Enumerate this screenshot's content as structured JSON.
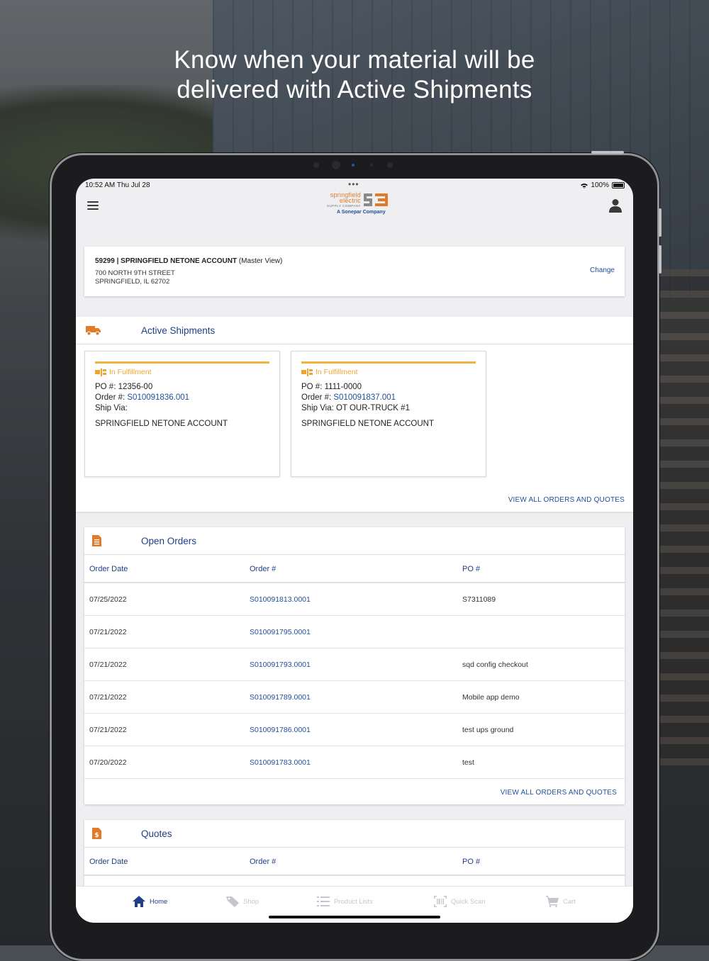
{
  "headline": {
    "line1": "Know when your material will be",
    "line2": "delivered with Active Shipments"
  },
  "status_bar": {
    "time": "10:52 AM   Thu Jul 28",
    "dots": "•••",
    "battery": "100%"
  },
  "logo": {
    "line1": "springfield",
    "line2": "electric",
    "supply": "SUPPLY COMPANY",
    "tagline": "A Sonepar Company"
  },
  "account": {
    "name": "59299 | SPRINGFIELD NETONE ACCOUNT",
    "view": "(Master View)",
    "street": "700 NORTH 9TH STREET",
    "city": "SPRINGFIELD, IL 62702",
    "change_label": "Change"
  },
  "active_shipments": {
    "title": "Active Shipments",
    "cards": [
      {
        "status": "In Fulfillment",
        "po_label": "PO #:",
        "po": "12356-00",
        "order_label": "Order #:",
        "order": "S010091836.001",
        "ship_via_label": "Ship Via:",
        "ship_via": "",
        "account": "SPRINGFIELD NETONE ACCOUNT"
      },
      {
        "status": "In Fulfillment",
        "po_label": "PO #:",
        "po": "1111-0000",
        "order_label": "Order #:",
        "order": "S010091837.001",
        "ship_via_label": "Ship Via:",
        "ship_via": "OT OUR-TRUCK #1",
        "account": "SPRINGFIELD NETONE ACCOUNT"
      }
    ],
    "view_all": "VIEW ALL ORDERS AND QUOTES"
  },
  "open_orders": {
    "title": "Open Orders",
    "columns": [
      "Order Date",
      "Order #",
      "PO #"
    ],
    "rows": [
      [
        "07/25/2022",
        "S010091813.0001",
        "S7311089"
      ],
      [
        "07/21/2022",
        "S010091795.0001",
        ""
      ],
      [
        "07/21/2022",
        "S010091793.0001",
        "sqd config checkout"
      ],
      [
        "07/21/2022",
        "S010091789.0001",
        "Mobile app demo"
      ],
      [
        "07/21/2022",
        "S010091786.0001",
        "test ups ground"
      ],
      [
        "07/20/2022",
        "S010091783.0001",
        "test"
      ]
    ],
    "view_all": "VIEW ALL ORDERS AND QUOTES"
  },
  "quotes": {
    "title": "Quotes",
    "columns": [
      "Order Date",
      "Order #",
      "PO #"
    ]
  },
  "tabs": [
    {
      "label": "Home",
      "icon": "home-icon",
      "active": true
    },
    {
      "label": "Shop",
      "icon": "tag-icon",
      "active": false
    },
    {
      "label": "Product Lists",
      "icon": "list-icon",
      "active": false
    },
    {
      "label": "Quick Scan",
      "icon": "barcode-icon",
      "active": false
    },
    {
      "label": "Cart",
      "icon": "cart-icon",
      "active": false
    }
  ],
  "colors": {
    "brand_orange": "#e07b2a",
    "brand_blue": "#1f3f87",
    "link_blue": "#1f4e9b",
    "fulfillment_yellow": "#f4b13e"
  }
}
